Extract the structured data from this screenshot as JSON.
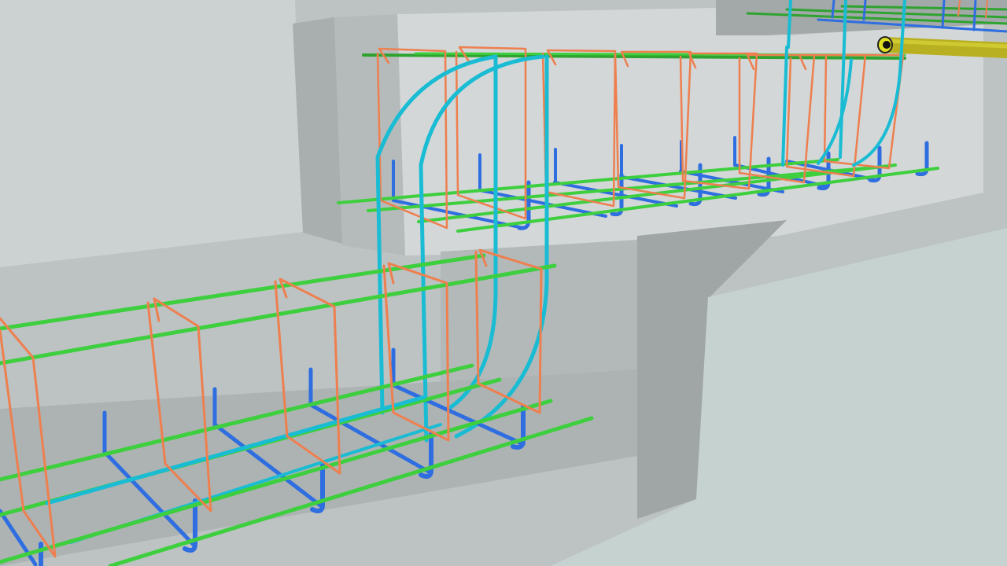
{
  "scene": {
    "type": "3d-rebar-model-viewport",
    "background": "#bcc2c2",
    "materials": {
      "concrete_light": "#d2d6d6",
      "concrete_mid": "#b9bfbf",
      "concrete_dark": "#a6acab",
      "floor": "#c5d2d0"
    },
    "rebar_colors": {
      "longitudinal_bar": "#3ecf3e",
      "stirrup": "#ee7f4f",
      "u_bar": "#2f6ee0",
      "bent_bar": "#19bcd3",
      "embedded_pipe": "#b8b020"
    },
    "visible_elements": [
      "upper-beam-cage",
      "lower-beam-cage",
      "transition-bent-bars",
      "embedded-pipe"
    ]
  }
}
